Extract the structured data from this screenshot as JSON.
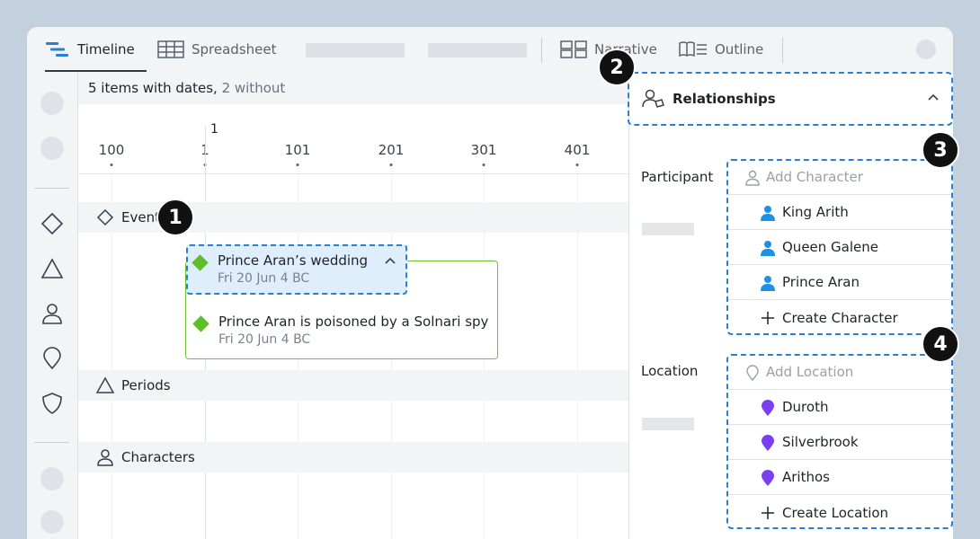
{
  "tabs": [
    {
      "label": "Timeline",
      "icon": "timeline-icon",
      "active": true
    },
    {
      "label": "Spreadsheet",
      "icon": "spreadsheet-icon",
      "active": false
    },
    {
      "label": "Narrative",
      "icon": "narrative-icon",
      "active": false
    },
    {
      "label": "Outline",
      "icon": "outline-icon",
      "active": false
    }
  ],
  "header": {
    "count_text": "5 items with dates, ",
    "without_text": "2 without"
  },
  "ruler": {
    "marker": "1",
    "ticks": [
      "100",
      "1",
      "101",
      "201",
      "301",
      "401"
    ]
  },
  "sections": {
    "events": "Events",
    "periods": "Periods",
    "characters": "Characters"
  },
  "events": [
    {
      "title": "Prince Aran’s wedding",
      "date": "Fri 20 Jun 4 BC"
    },
    {
      "title": "Prince Aran is poisoned by a Solnari spy",
      "date": "Fri 20 Jun 4 BC"
    }
  ],
  "panel": {
    "title": "Relationships",
    "participant_label": "Participant",
    "add_character_placeholder": "Add Character",
    "characters": [
      "King Arith",
      "Queen Galene",
      "Prince Aran"
    ],
    "create_character": "Create Character",
    "location_label": "Location",
    "add_location_placeholder": "Add Location",
    "locations": [
      "Duroth",
      "Silverbrook",
      "Arithos"
    ],
    "create_location": "Create Location"
  },
  "badges": [
    "1",
    "2",
    "3",
    "4"
  ],
  "colors": {
    "accent": "#2a7fd4",
    "event_green": "#5cbf2a",
    "character_blue": "#1e90e6",
    "location_purple": "#7b3ff2"
  }
}
